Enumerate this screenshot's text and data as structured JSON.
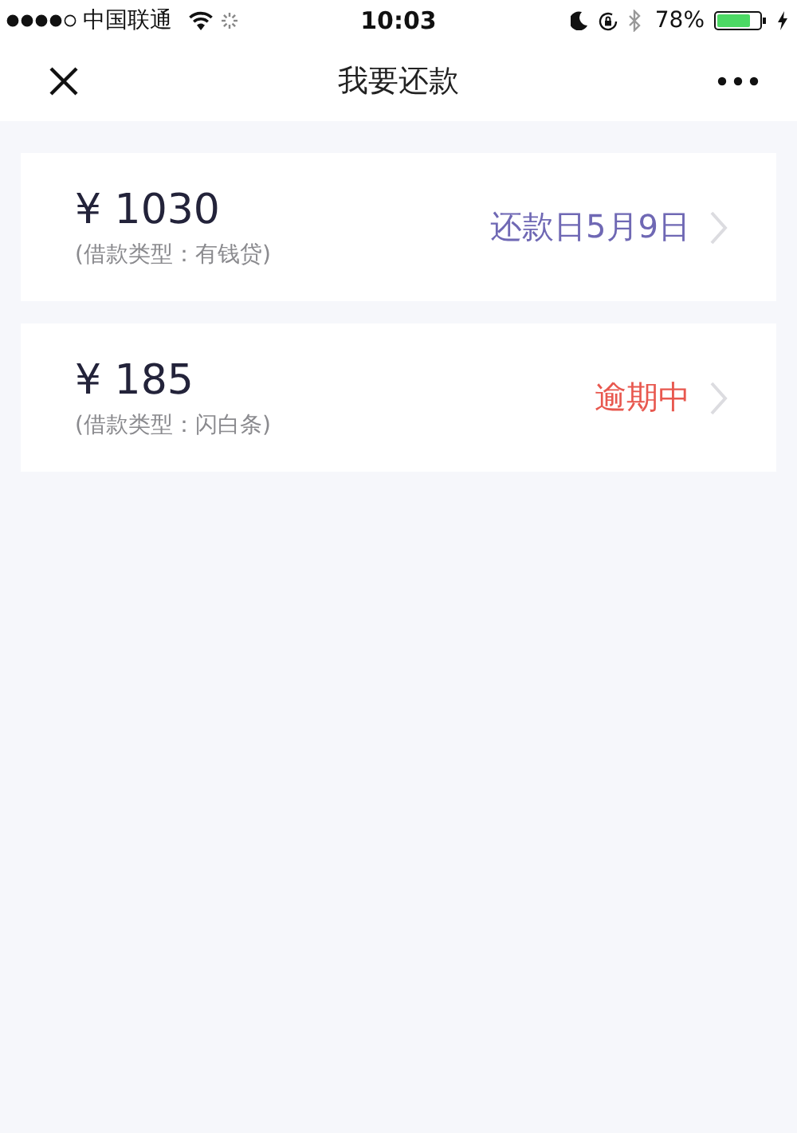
{
  "status_bar": {
    "carrier": "中国联通",
    "time": "10:03",
    "battery": "78%"
  },
  "nav": {
    "title": "我要还款"
  },
  "loans": [
    {
      "amount": "¥ 1030",
      "type": "(借款类型：有钱贷)",
      "status": "还款日5月9日",
      "color": "#6f68b4"
    },
    {
      "amount": "¥ 185",
      "type": "(借款类型：闪白条)",
      "status": "逾期中",
      "color": "#e8584f"
    }
  ]
}
